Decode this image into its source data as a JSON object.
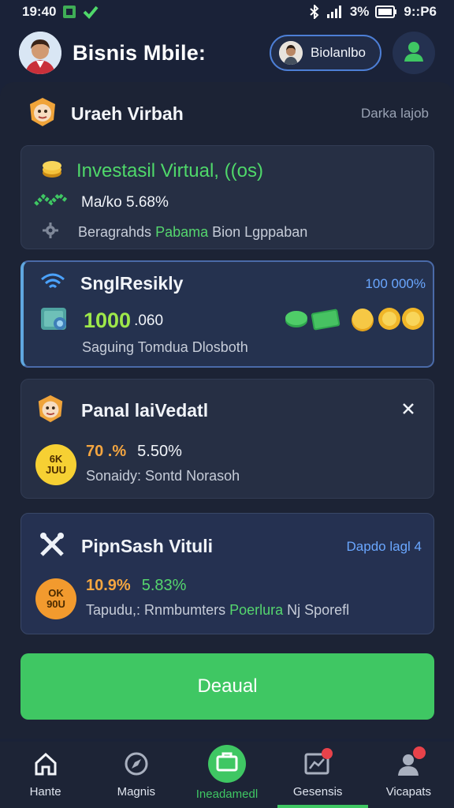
{
  "status_bar": {
    "time": "19:40",
    "battery": "3%",
    "clock_right": "9::P6"
  },
  "header": {
    "app_title": "Bisnis Mbile:",
    "account_label": "Biolanlbo"
  },
  "section": {
    "title": "Uraeh Virbah",
    "link": "Darka lajob"
  },
  "cards": [
    {
      "title": "Investasil Virtual, ((os)",
      "line1": "Ma/ko 5.68%",
      "line2_prefix": "Beragrahds ",
      "line2_highlight": "Pabama",
      "line2_suffix": " Bion Lgppaban"
    },
    {
      "title": "SnglResikly",
      "right_value": "100 000%",
      "amount_main": "1000",
      "amount_suffix": ".060",
      "caption": "Saguing Tomdua Dlosboth"
    },
    {
      "title": "Panal laiVedatl",
      "coin_top": "6K",
      "coin_bottom": "JUU",
      "pct_orange": "70 .%",
      "pct_white": "5.50%",
      "caption": "Sonaidy: Sontd Norasoh"
    },
    {
      "title": "PipnSash Vituli",
      "right_link": "Dapdo lagl 4",
      "coin_top": "OK",
      "coin_bottom": "90U",
      "pct_orange": "10.9%",
      "pct_green": "5.83%",
      "caption_prefix": "Tapudu,: Rnmbumters ",
      "caption_highlight": "Poerlura",
      "caption_suffix": " Nj Sporefl"
    }
  ],
  "primary_button": {
    "label": "Deaual"
  },
  "bottom_nav": [
    {
      "label": "Hante",
      "icon": "home-icon",
      "active": false
    },
    {
      "label": "Magnis",
      "icon": "compass-icon",
      "active": false
    },
    {
      "label": "Ineadamedl",
      "icon": "briefcase-icon",
      "active": true
    },
    {
      "label": "Gesensis",
      "icon": "chart-board-icon",
      "active": false
    },
    {
      "label": "Vicapats",
      "icon": "user-icon",
      "active": false
    }
  ],
  "colors": {
    "accent_green": "#3fc763",
    "accent_blue": "#4d7fd6",
    "bg": "#1a2238",
    "orange": "#f5a640"
  }
}
